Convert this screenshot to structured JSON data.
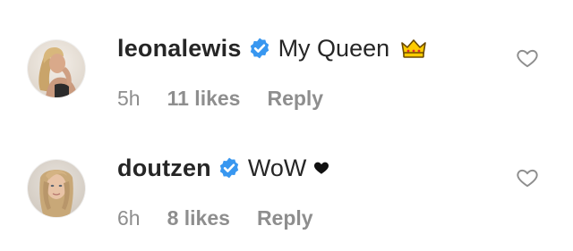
{
  "comments": [
    {
      "username": "leonalewis",
      "verified": true,
      "text": "My Queen",
      "emoji": "crown-icon",
      "time": "5h",
      "likes": "11 likes",
      "reply": "Reply"
    },
    {
      "username": "doutzen",
      "verified": true,
      "text": "WoW",
      "emoji": "black-heart-icon",
      "time": "6h",
      "likes": "8 likes",
      "reply": "Reply"
    }
  ],
  "colors": {
    "text": "#262626",
    "meta": "#8e8e8e",
    "verified": "#3897f0",
    "heart_outline": "#8e8e8e",
    "crown": "#ffcc00"
  }
}
